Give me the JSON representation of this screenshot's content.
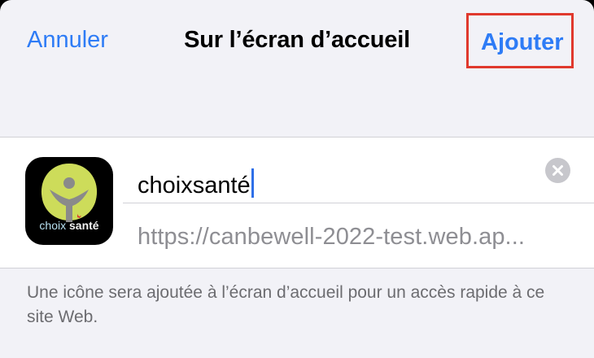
{
  "navbar": {
    "cancel_label": "Annuler",
    "title": "Sur l’écran d’accueil",
    "add_label": "Ajouter"
  },
  "app": {
    "icon_text_part1": "choix ",
    "icon_text_part2": "santé",
    "name_value": "choixsanté",
    "url_value": "https://canbewell-2022-test.web.ap..."
  },
  "footer": {
    "note": "Une icône sera ajoutée à l’écran d’accueil pour un accès rapide à ce site Web."
  },
  "colors": {
    "accent": "#2e7cf6",
    "highlight_border": "#e0392d",
    "icon_leaf": "#cddc5a"
  },
  "icons": {
    "clear": "clear-circle-icon",
    "app": "choix-sante-app-icon"
  }
}
